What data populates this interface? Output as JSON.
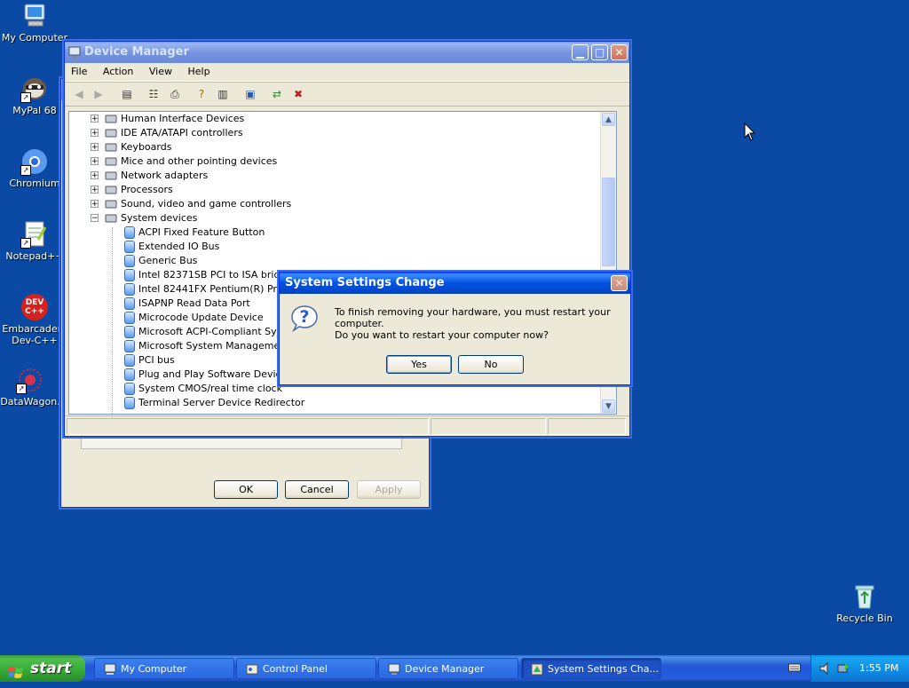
{
  "desktop": {
    "icons": [
      {
        "label": "My Computer"
      },
      {
        "label": "MyPal 68"
      },
      {
        "label": "Chromium"
      },
      {
        "label": "Notepad++"
      },
      {
        "label": "Embarcadero Dev-C++"
      },
      {
        "label": "DataWagon."
      },
      {
        "label": "Recycle Bin"
      }
    ],
    "devcpp_icon_text": "DEV C++"
  },
  "back_dialog": {
    "ok": "OK",
    "cancel": "Cancel",
    "apply": "Apply"
  },
  "device_manager": {
    "title": "Device Manager",
    "menu": [
      "File",
      "Action",
      "View",
      "Help"
    ],
    "tree": [
      {
        "label": "Human Interface Devices",
        "type": "category",
        "expander": "+"
      },
      {
        "label": "IDE ATA/ATAPI controllers",
        "type": "category",
        "expander": "+"
      },
      {
        "label": "Keyboards",
        "type": "category",
        "expander": "+"
      },
      {
        "label": "Mice and other pointing devices",
        "type": "category",
        "expander": "+"
      },
      {
        "label": "Network adapters",
        "type": "category",
        "expander": "+"
      },
      {
        "label": "Processors",
        "type": "category",
        "expander": "+"
      },
      {
        "label": "Sound, video and game controllers",
        "type": "category",
        "expander": "+"
      },
      {
        "label": "System devices",
        "type": "category",
        "expander": "−"
      },
      {
        "label": "ACPI Fixed Feature Button",
        "type": "device"
      },
      {
        "label": "Extended IO Bus",
        "type": "device"
      },
      {
        "label": "Generic Bus",
        "type": "device"
      },
      {
        "label": "Intel 82371SB PCI to ISA bridge",
        "type": "device"
      },
      {
        "label": "Intel 82441FX Pentium(R) Pro Pro",
        "type": "device"
      },
      {
        "label": "ISAPNP Read Data Port",
        "type": "device"
      },
      {
        "label": "Microcode Update Device",
        "type": "device"
      },
      {
        "label": "Microsoft ACPI-Compliant System",
        "type": "device"
      },
      {
        "label": "Microsoft System Management BI",
        "type": "device"
      },
      {
        "label": "PCI bus",
        "type": "device"
      },
      {
        "label": "Plug and Play Software Device En",
        "type": "device"
      },
      {
        "label": "System CMOS/real time clock",
        "type": "device"
      },
      {
        "label": "Terminal Server Device Redirector",
        "type": "device"
      }
    ]
  },
  "dialog": {
    "title": "System Settings Change",
    "message1": "To finish removing your hardware, you must restart your computer.",
    "message2": "Do you want to restart your computer now?",
    "yes": "Yes",
    "no": "No",
    "icon_glyph": "?"
  },
  "taskbar": {
    "start_label": "start",
    "tasks": [
      {
        "label": "My Computer"
      },
      {
        "label": "Control Panel"
      },
      {
        "label": "Device Manager"
      },
      {
        "label": "System Settings Cha..."
      }
    ],
    "clock": "1:55 PM"
  },
  "colors": {
    "desktop": "#0b4aa4",
    "title_active": "#0052e0",
    "window_face": "#ece9d8",
    "start_green": "#34a834"
  }
}
